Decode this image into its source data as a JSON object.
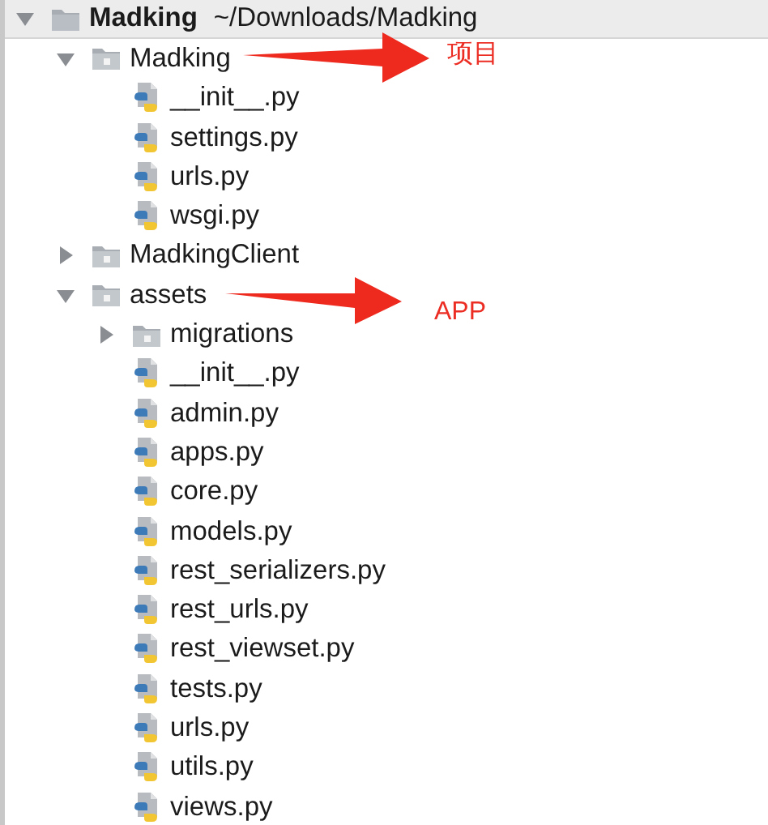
{
  "root": {
    "name": "Madking",
    "path": "~/Downloads/Madking",
    "expanded": true,
    "children": [
      {
        "kind": "folder",
        "name": "Madking",
        "expanded": true,
        "children": [
          {
            "kind": "file",
            "name": "__init__.py"
          },
          {
            "kind": "file",
            "name": "settings.py"
          },
          {
            "kind": "file",
            "name": "urls.py"
          },
          {
            "kind": "file",
            "name": "wsgi.py"
          }
        ]
      },
      {
        "kind": "folder",
        "name": "MadkingClient",
        "expanded": false
      },
      {
        "kind": "folder",
        "name": "assets",
        "expanded": true,
        "children": [
          {
            "kind": "folder",
            "name": "migrations",
            "expanded": false
          },
          {
            "kind": "file",
            "name": "__init__.py"
          },
          {
            "kind": "file",
            "name": "admin.py"
          },
          {
            "kind": "file",
            "name": "apps.py"
          },
          {
            "kind": "file",
            "name": "core.py"
          },
          {
            "kind": "file",
            "name": "models.py"
          },
          {
            "kind": "file",
            "name": "rest_serializers.py"
          },
          {
            "kind": "file",
            "name": "rest_urls.py"
          },
          {
            "kind": "file",
            "name": "rest_viewset.py"
          },
          {
            "kind": "file",
            "name": "tests.py"
          },
          {
            "kind": "file",
            "name": "urls.py"
          },
          {
            "kind": "file",
            "name": "utils.py"
          },
          {
            "kind": "file",
            "name": "views.py"
          }
        ]
      }
    ]
  },
  "annotations": [
    {
      "text": "项目"
    },
    {
      "text": "APP"
    }
  ]
}
